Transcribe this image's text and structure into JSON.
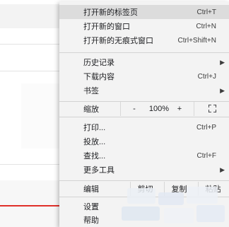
{
  "menu": {
    "new_tab": {
      "label": "打开新的标签页",
      "shortcut": "Ctrl+T"
    },
    "new_window": {
      "label": "打开新的窗口",
      "shortcut": "Ctrl+N"
    },
    "incognito": {
      "label": "打开新的无痕式窗口",
      "shortcut": "Ctrl+Shift+N"
    },
    "history": {
      "label": "历史记录"
    },
    "downloads": {
      "label": "下载内容",
      "shortcut": "Ctrl+J"
    },
    "bookmarks": {
      "label": "书签"
    },
    "zoom": {
      "label": "缩放",
      "minus": "-",
      "value": "100%",
      "plus": "+"
    },
    "print": {
      "label": "打印...",
      "shortcut": "Ctrl+P"
    },
    "cast": {
      "label": "投放..."
    },
    "find": {
      "label": "查找...",
      "shortcut": "Ctrl+F"
    },
    "more_tools": {
      "label": "更多工具"
    },
    "edit": {
      "label": "编辑",
      "cut": "剪切",
      "copy": "复制",
      "paste": "粘贴"
    },
    "settings": {
      "label": "设置"
    },
    "help": {
      "label": "帮助"
    }
  },
  "icons": {
    "submenu": "chevron-right-icon",
    "fullscreen": "fullscreen-icon",
    "annotation": "red-arrow-icon"
  },
  "colors": {
    "menu_bg": "#f3f3f3",
    "hover_bg": "#dcdcdc",
    "annotation_arrow": "#e0302a"
  }
}
